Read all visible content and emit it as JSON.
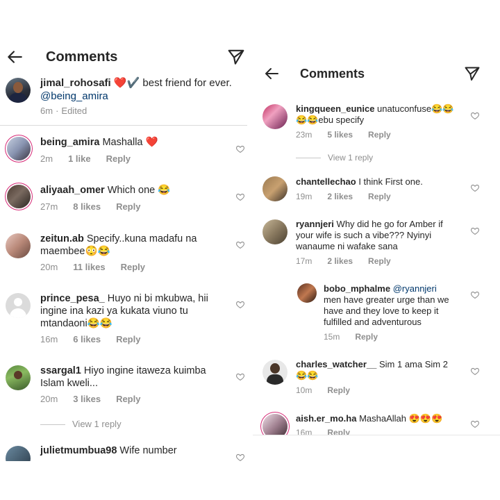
{
  "left": {
    "title": "Comments",
    "caption": {
      "user": "jimal_rohosafi",
      "emoji": "❤️✔️",
      "text": "best friend for ever.",
      "mention": "@being_amira",
      "time": "6m",
      "edited": "Edited"
    },
    "comments": [
      {
        "user": "being_amira",
        "text": "Mashalla ❤️",
        "time": "2m",
        "likes": "1 like",
        "reply": "Reply"
      },
      {
        "user": "aliyaah_omer",
        "text": "Which one 😂",
        "time": "27m",
        "likes": "8 likes",
        "reply": "Reply"
      },
      {
        "user": "zeitun.ab",
        "text": "Specify..kuna madafu na maembee😳😂",
        "time": "20m",
        "likes": "11 likes",
        "reply": "Reply"
      },
      {
        "user": "prince_pesa_",
        "text": "Huyo ni bi mkubwa, hii ingine ina kazi ya kukata viuno tu mtandaoni😂😂",
        "time": "16m",
        "likes": "6 likes",
        "reply": "Reply"
      },
      {
        "user": "ssargal1",
        "text": "Hiyo ingine itaweza kuimba Islam kweli...",
        "time": "20m",
        "likes": "3 likes",
        "reply": "Reply"
      },
      {
        "user": "julietmumbua98",
        "text": "Wife number"
      }
    ],
    "view_reply": "View 1 reply"
  },
  "right": {
    "title": "Comments",
    "comments": [
      {
        "user": "kingqueen_eunice",
        "text": "unatuconfuse😂😂😂😂ebu specify",
        "time": "23m",
        "likes": "5 likes",
        "reply": "Reply"
      },
      {
        "user": "chantellechao",
        "text": "I think First one.",
        "time": "19m",
        "likes": "2 likes",
        "reply": "Reply"
      },
      {
        "user": "ryannjeri",
        "text": "Why did he go for Amber if your wife is such a vibe??? Nyinyi wanaume ni wafake sana",
        "time": "17m",
        "likes": "2 likes",
        "reply": "Reply"
      },
      {
        "user": "bobo_mphalme",
        "mention": "@ryannjeri",
        "text": "men have greater urge than we have and they love to keep it fulfilled and adventurous",
        "time": "15m",
        "reply": "Reply"
      },
      {
        "user": "charles_watcher__",
        "text": "Sim 1 ama Sim 2 😂😂",
        "time": "10m",
        "reply": "Reply"
      },
      {
        "user": "aish.er_mo.ha",
        "text": "MashaAllah 😍😍😍",
        "time": "16m",
        "reply": "Reply"
      }
    ],
    "view_reply": "View 1 reply"
  },
  "colors": {
    "text": "#262626",
    "meta": "#8e8e8e",
    "link": "#00376b",
    "heart": "#ed4956",
    "story_ring": "#d62976"
  }
}
